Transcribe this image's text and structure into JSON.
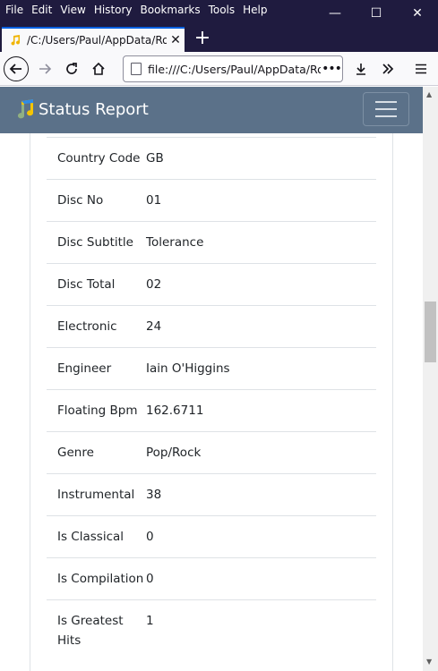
{
  "menu": [
    "File",
    "Edit",
    "View",
    "History",
    "Bookmarks",
    "Tools",
    "Help"
  ],
  "window_controls": {
    "minimize": "—",
    "maximize": "☐",
    "close": "✕"
  },
  "tab": {
    "title": "/C:/Users/Paul/AppData/Roam",
    "close": "✕"
  },
  "new_tab": "+",
  "url": "file:///C:/Users/Paul/AppData/Roa",
  "url_more": "•••",
  "app": {
    "brand": "Status Report"
  },
  "rows": [
    {
      "key": "Country Code",
      "value": "GB"
    },
    {
      "key": "Disc No",
      "value": "01"
    },
    {
      "key": "Disc Subtitle",
      "value": "Tolerance"
    },
    {
      "key": "Disc Total",
      "value": "02"
    },
    {
      "key": "Electronic",
      "value": "24"
    },
    {
      "key": "Engineer",
      "value": "Iain O'Higgins"
    },
    {
      "key": "Floating Bpm",
      "value": "162.6711"
    },
    {
      "key": "Genre",
      "value": "Pop/Rock"
    },
    {
      "key": "Instrumental",
      "value": "38"
    },
    {
      "key": "Is Classical",
      "value": "0"
    },
    {
      "key": "Is Compilation",
      "value": "0"
    },
    {
      "key": "Is Greatest Hits",
      "value": "1"
    }
  ],
  "colors": {
    "titlebar": "#1f1b3f",
    "appnav": "#5b7189",
    "accent": "#0060df"
  },
  "icons": [
    "back-arrow-icon",
    "forward-arrow-icon",
    "reload-icon",
    "home-icon",
    "page-icon",
    "download-icon",
    "overflow-chevrons-icon",
    "hamburger-menu-icon",
    "music-note-icon"
  ]
}
